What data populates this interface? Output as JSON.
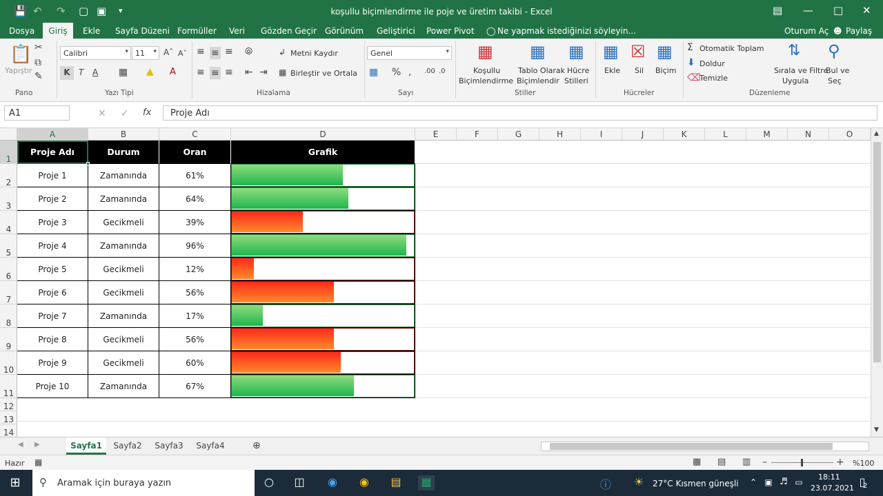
{
  "window": {
    "title": "koşullu biçimlendirme ile poje ve üretim takibi - Excel"
  },
  "menu": {
    "file": "Dosya",
    "home": "Giriş",
    "insert": "Ekle",
    "layout": "Sayfa Düzeni",
    "formulas": "Formüller",
    "data": "Veri",
    "review": "Gözden Geçir",
    "view": "Görünüm",
    "developer": "Geliştirici",
    "powerpivot": "Power Pivot",
    "tellme": "Ne yapmak istediğinizi söyleyin...",
    "signin": "Oturum Aç",
    "share": "Paylaş"
  },
  "ribbon": {
    "paste": "Yapıştır",
    "font_name": "Calibri",
    "font_size": "11",
    "bold": "K",
    "italic": "T",
    "underline": "A",
    "wrap": "Metni Kaydır",
    "merge": "Birleştir ve Ortala",
    "number_format": "Genel",
    "cond_format_1": "Koşullu",
    "cond_format_2": "Biçimlendirme",
    "table_fmt_1": "Tablo Olarak",
    "table_fmt_2": "Biçimlendir",
    "cell_styles_1": "Hücre",
    "cell_styles_2": "Stilleri",
    "insert": "Ekle",
    "delete": "Sil",
    "format": "Biçim",
    "autosum": "Otomatik Toplam",
    "fill": "Doldur",
    "clear": "Temizle",
    "sort_1": "Sırala ve Filtre",
    "sort_2": "Uygula",
    "find_1": "Bul ve",
    "find_2": "Seç",
    "groups": {
      "clipboard": "Pano",
      "font": "Yazı Tipi",
      "alignment": "Hizalama",
      "number": "Sayı",
      "styles": "Stiller",
      "cells": "Hücreler",
      "editing": "Düzenleme"
    }
  },
  "formula_bar": {
    "namebox": "A1",
    "fx": "fx",
    "content": "Proje Adı"
  },
  "columns": [
    "A",
    "B",
    "C",
    "D",
    "E",
    "F",
    "G",
    "H",
    "I",
    "J",
    "K",
    "L",
    "M",
    "N",
    "O"
  ],
  "rows": [
    "1",
    "2",
    "3",
    "4",
    "5",
    "6",
    "7",
    "8",
    "9",
    "10",
    "11",
    "12",
    "13",
    "14"
  ],
  "table": {
    "headers": [
      "Proje Adı",
      "Durum",
      "Oran",
      "Grafik"
    ],
    "rows": [
      {
        "name": "Proje 1",
        "status": "Zamanında",
        "rate": "61%",
        "value": 0.61,
        "color": "green"
      },
      {
        "name": "Proje 2",
        "status": "Zamanında",
        "rate": "64%",
        "value": 0.64,
        "color": "green"
      },
      {
        "name": "Proje 3",
        "status": "Gecikmeli",
        "rate": "39%",
        "value": 0.39,
        "color": "red"
      },
      {
        "name": "Proje 4",
        "status": "Zamanında",
        "rate": "96%",
        "value": 0.96,
        "color": "green"
      },
      {
        "name": "Proje 5",
        "status": "Gecikmeli",
        "rate": "12%",
        "value": 0.12,
        "color": "red"
      },
      {
        "name": "Proje 6",
        "status": "Gecikmeli",
        "rate": "56%",
        "value": 0.56,
        "color": "red"
      },
      {
        "name": "Proje 7",
        "status": "Zamanında",
        "rate": "17%",
        "value": 0.17,
        "color": "green"
      },
      {
        "name": "Proje 8",
        "status": "Gecikmeli",
        "rate": "56%",
        "value": 0.56,
        "color": "red"
      },
      {
        "name": "Proje 9",
        "status": "Gecikmeli",
        "rate": "60%",
        "value": 0.6,
        "color": "red"
      },
      {
        "name": "Proje 10",
        "status": "Zamanında",
        "rate": "67%",
        "value": 0.67,
        "color": "green"
      }
    ]
  },
  "sheets": [
    "Sayfa1",
    "Sayfa2",
    "Sayfa3",
    "Sayfa4"
  ],
  "status": {
    "ready": "Hazır",
    "zoom": "%100"
  },
  "taskbar": {
    "search": "Aramak için buraya yazın",
    "weather": "27°C  Kısmen güneşli",
    "time": "18:11",
    "date": "23.07.2021",
    "notif": "2"
  },
  "colors": {
    "excel_green": "#217346",
    "bar_green": "#1fb64e",
    "bar_red": "#ff2a1a"
  }
}
